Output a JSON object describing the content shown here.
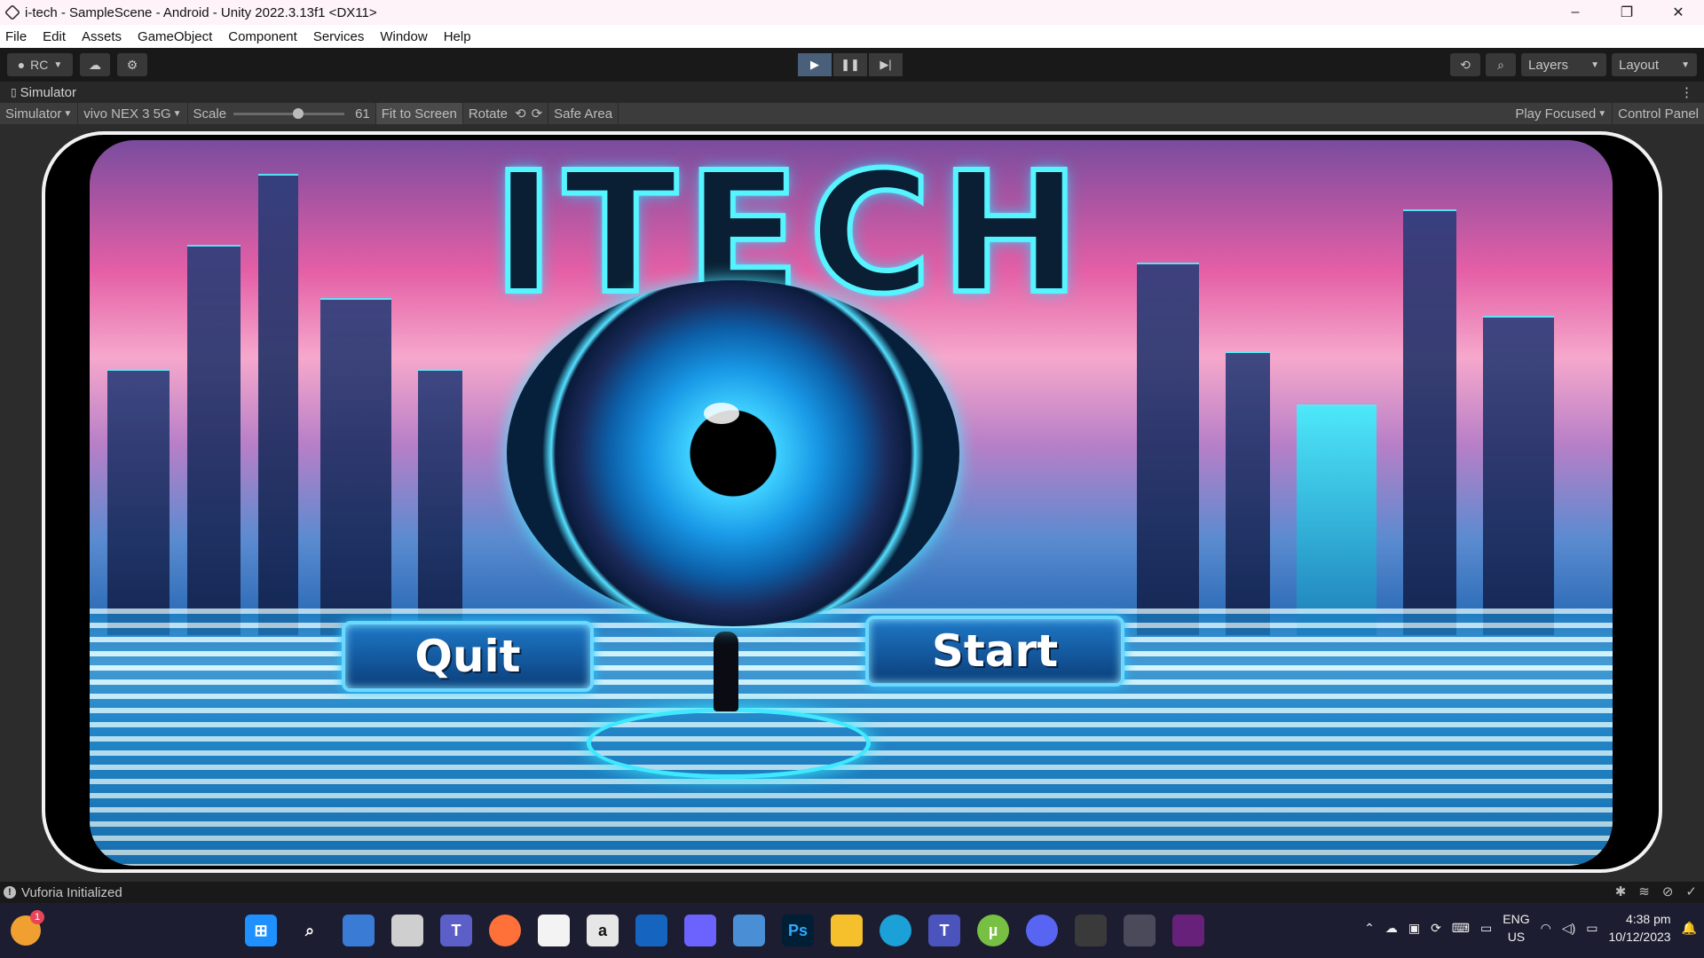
{
  "window": {
    "title": "i-tech - SampleScene - Android - Unity 2022.3.13f1 <DX11>",
    "minimize": "–",
    "restore": "❐",
    "close": "✕"
  },
  "menu": [
    "File",
    "Edit",
    "Assets",
    "GameObject",
    "Component",
    "Services",
    "Window",
    "Help"
  ],
  "toolbar": {
    "account": "RC",
    "layers": "Layers",
    "layout": "Layout"
  },
  "tab": {
    "label": "Simulator"
  },
  "simulator": {
    "mode": "Simulator",
    "device": "vivo NEX 3 5G",
    "scale_label": "Scale",
    "scale_value": "61",
    "fit_to_screen": "Fit to Screen",
    "rotate": "Rotate",
    "safe_area": "Safe Area",
    "play_focused": "Play Focused",
    "control_panel": "Control Panel"
  },
  "game": {
    "logo": "ITECH",
    "quit_label": "Quit",
    "start_label": "Start"
  },
  "status": {
    "message": "Vuforia Initialized"
  },
  "taskbar": {
    "lang_top": "ENG",
    "lang_bottom": "US",
    "time": "4:38 pm",
    "date": "10/12/2023",
    "weather_badge": "1"
  },
  "colors": {
    "accent": "#55f4ff",
    "unity_dark": "#191919",
    "taskbar": "#1c1d30"
  }
}
